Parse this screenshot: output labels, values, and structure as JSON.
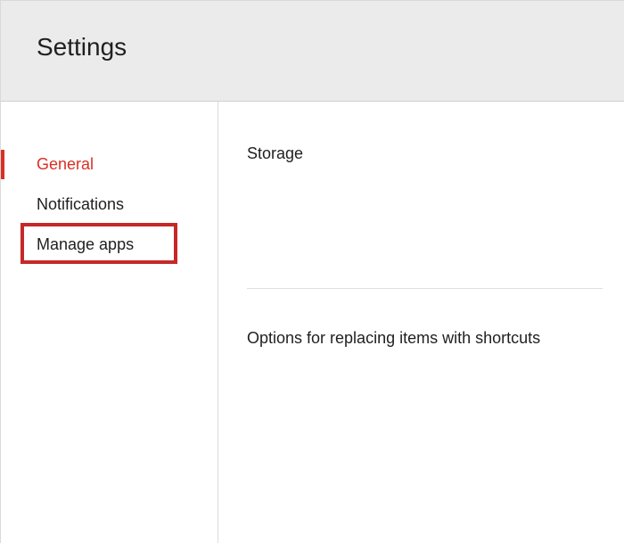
{
  "header": {
    "title": "Settings"
  },
  "sidebar": {
    "items": [
      {
        "label": "General"
      },
      {
        "label": "Notifications"
      },
      {
        "label": "Manage apps"
      }
    ]
  },
  "content": {
    "section1_heading": "Storage",
    "section2_heading": "Options for replacing items with shortcuts"
  }
}
